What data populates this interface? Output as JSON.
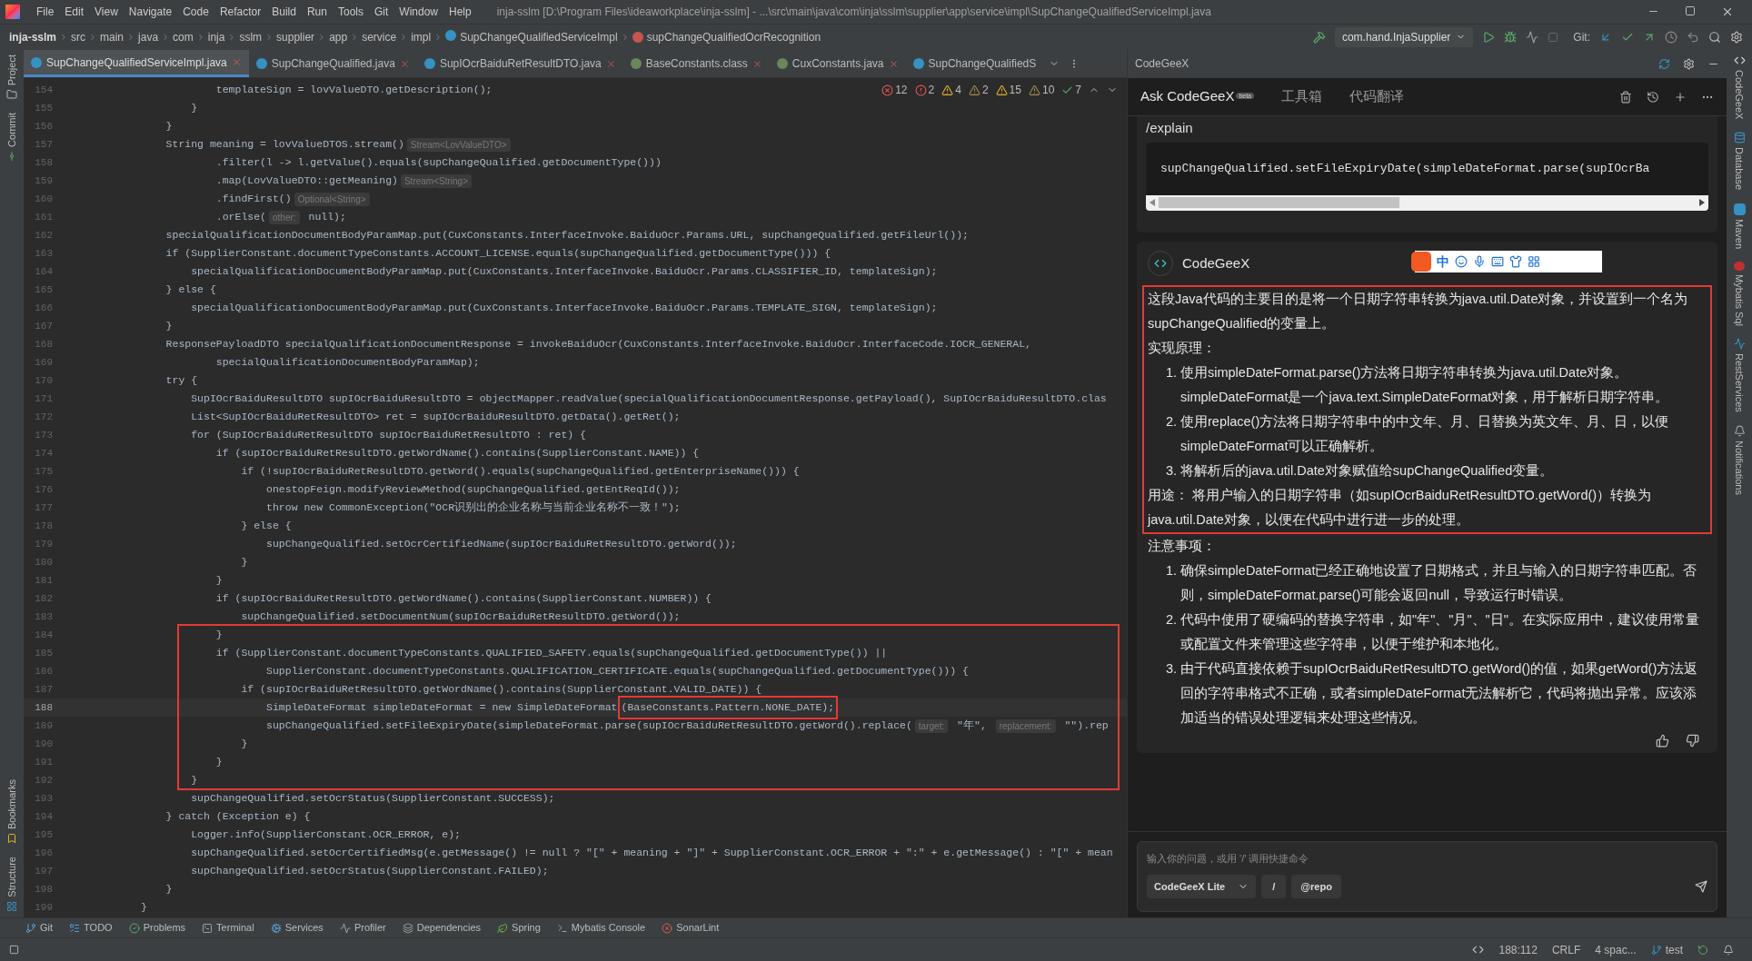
{
  "menu_bar": {
    "items": [
      "File",
      "Edit",
      "View",
      "Navigate",
      "Code",
      "Refactor",
      "Build",
      "Run",
      "Tools",
      "Git",
      "Window",
      "Help"
    ],
    "title": "inja-sslm [D:\\Program Files\\ideaworkplace\\inja-sslm] - ...\\src\\main\\java\\com\\inja\\sslm\\supplier\\app\\service\\impl\\SupChangeQualifiedServiceImpl.java"
  },
  "breadcrumbs": [
    {
      "label": "inja-sslm",
      "kind": "project"
    },
    {
      "label": "src",
      "kind": "folder"
    },
    {
      "label": "main",
      "kind": "folder"
    },
    {
      "label": "java",
      "kind": "folder"
    },
    {
      "label": "com",
      "kind": "folder"
    },
    {
      "label": "inja",
      "kind": "folder"
    },
    {
      "label": "sslm",
      "kind": "folder"
    },
    {
      "label": "supplier",
      "kind": "folder"
    },
    {
      "label": "app",
      "kind": "folder"
    },
    {
      "label": "service",
      "kind": "folder"
    },
    {
      "label": "impl",
      "kind": "folder"
    },
    {
      "label": "SupChangeQualifiedServiceImpl",
      "kind": "class"
    },
    {
      "label": "supChangeQualifiedOcrRecognition",
      "kind": "method"
    }
  ],
  "run_config": "com.hand.InjaSupplier",
  "git_label": "Git:",
  "tabs": [
    {
      "label": "SupChangeQualifiedServiceImpl.java",
      "selected": true,
      "kind": "class"
    },
    {
      "label": "SupChangeQualified.java",
      "selected": false,
      "kind": "class"
    },
    {
      "label": "SupIOcrBaiduRetResultDTO.java",
      "selected": false,
      "kind": "class"
    },
    {
      "label": "BaseConstants.class",
      "selected": false,
      "kind": "compiled"
    },
    {
      "label": "CuxConstants.java",
      "selected": false,
      "kind": "interface"
    },
    {
      "label": "SupChangeQualifiedS",
      "selected": false,
      "kind": "class"
    }
  ],
  "left_tools": {
    "top": [
      "Project",
      "Commit"
    ],
    "bottom": [
      "Bookmarks",
      "Structure"
    ]
  },
  "inspections": [
    {
      "count": "12",
      "kind": "error-outline"
    },
    {
      "count": "2",
      "kind": "error"
    },
    {
      "count": "4",
      "kind": "warning"
    },
    {
      "count": "2",
      "kind": "weak"
    },
    {
      "count": "15",
      "kind": "warning"
    },
    {
      "count": "10",
      "kind": "weak"
    },
    {
      "count": "7",
      "kind": "ok"
    }
  ],
  "code": [
    {
      "number": "154",
      "current": false,
      "parts": [
        {
          "kind": "code",
          "text": "            templateSign = lovValueDTO.getDescription();"
        }
      ]
    },
    {
      "number": "155",
      "current": false,
      "parts": [
        {
          "kind": "code",
          "text": "        }"
        }
      ]
    },
    {
      "number": "156",
      "current": false,
      "parts": [
        {
          "kind": "code",
          "text": "    }"
        }
      ]
    },
    {
      "number": "157",
      "current": false,
      "parts": [
        {
          "kind": "code",
          "text": "    String meaning = lovValueDTOS.stream()"
        },
        {
          "kind": "hint",
          "text": "Stream<LovValueDTO>"
        }
      ]
    },
    {
      "number": "158",
      "current": false,
      "parts": [
        {
          "kind": "code",
          "text": "            .filter(l -> l.getValue().equals(supChangeQualified.getDocumentType()))"
        }
      ]
    },
    {
      "number": "159",
      "current": false,
      "parts": [
        {
          "kind": "code",
          "text": "            .map(LovValueDTO::getMeaning)"
        },
        {
          "kind": "hint",
          "text": "Stream<String>"
        }
      ]
    },
    {
      "number": "160",
      "current": false,
      "parts": [
        {
          "kind": "code",
          "text": "            .findFirst()"
        },
        {
          "kind": "hint",
          "text": "Optional<String>"
        }
      ]
    },
    {
      "number": "161",
      "current": false,
      "parts": [
        {
          "kind": "code",
          "text": "            .orElse("
        },
        {
          "kind": "hint",
          "text": "other:"
        },
        {
          "kind": "code",
          "text": " null);"
        }
      ]
    },
    {
      "number": "162",
      "current": false,
      "parts": [
        {
          "kind": "code",
          "text": "    specialQualificationDocumentBodyParamMap.put(CuxConstants.InterfaceInvoke.BaiduOcr.Params.URL, supChangeQualified.getFileUrl());"
        }
      ]
    },
    {
      "number": "163",
      "current": false,
      "parts": [
        {
          "kind": "code",
          "text": "    if (SupplierConstant.documentTypeConstants.ACCOUNT_LICENSE.equals(supChangeQualified.getDocumentType())) {"
        }
      ]
    },
    {
      "number": "164",
      "current": false,
      "parts": [
        {
          "kind": "code",
          "text": "        specialQualificationDocumentBodyParamMap.put(CuxConstants.InterfaceInvoke.BaiduOcr.Params.CLASSIFIER_ID, templateSign);"
        }
      ]
    },
    {
      "number": "165",
      "current": false,
      "parts": [
        {
          "kind": "code",
          "text": "    } else {"
        }
      ]
    },
    {
      "number": "166",
      "current": false,
      "parts": [
        {
          "kind": "code",
          "text": "        specialQualificationDocumentBodyParamMap.put(CuxConstants.InterfaceInvoke.BaiduOcr.Params.TEMPLATE_SIGN, templateSign);"
        }
      ]
    },
    {
      "number": "167",
      "current": false,
      "parts": [
        {
          "kind": "code",
          "text": "    }"
        }
      ]
    },
    {
      "number": "168",
      "current": false,
      "parts": [
        {
          "kind": "code",
          "text": "    ResponsePayloadDTO specialQualificationDocumentResponse = invokeBaiduOcr(CuxConstants.InterfaceInvoke.BaiduOcr.InterfaceCode.IOCR_GENERAL,"
        }
      ]
    },
    {
      "number": "169",
      "current": false,
      "parts": [
        {
          "kind": "code",
          "text": "            specialQualificationDocumentBodyParamMap);"
        }
      ]
    },
    {
      "number": "170",
      "current": false,
      "parts": [
        {
          "kind": "code",
          "text": "    try {"
        }
      ]
    },
    {
      "number": "171",
      "current": false,
      "parts": [
        {
          "kind": "code",
          "text": "        SupIOcrBaiduResultDTO supIOcrBaiduResultDTO = objectMapper.readValue(specialQualificationDocumentResponse.getPayload(), SupIOcrBaiduResultDTO.clas"
        }
      ]
    },
    {
      "number": "172",
      "current": false,
      "parts": [
        {
          "kind": "code",
          "text": "        List<SupIOcrBaiduRetResultDTO> ret = supIOcrBaiduResultDTO.getData().getRet();"
        }
      ]
    },
    {
      "number": "173",
      "current": false,
      "parts": [
        {
          "kind": "code",
          "text": "        for (SupIOcrBaiduRetResultDTO supIOcrBaiduRetResultDTO : ret) {"
        }
      ]
    },
    {
      "number": "174",
      "current": false,
      "parts": [
        {
          "kind": "code",
          "text": "            if (supIOcrBaiduRetResultDTO.getWordName().contains(SupplierConstant.NAME)) {"
        }
      ]
    },
    {
      "number": "175",
      "current": false,
      "parts": [
        {
          "kind": "code",
          "text": "                if (!supIOcrBaiduRetResultDTO.getWord().equals(supChangeQualified.getEnterpriseName())) {"
        }
      ]
    },
    {
      "number": "176",
      "current": false,
      "parts": [
        {
          "kind": "code",
          "text": "                    onestopFeign.modifyReviewMethod(supChangeQualified.getEntReqId());"
        }
      ]
    },
    {
      "number": "177",
      "current": false,
      "parts": [
        {
          "kind": "code",
          "text": "                    throw new CommonException(\"OCR识别出的企业名称与当前企业名称不一致！\");"
        }
      ]
    },
    {
      "number": "178",
      "current": false,
      "parts": [
        {
          "kind": "code",
          "text": "                } else {"
        }
      ]
    },
    {
      "number": "179",
      "current": false,
      "parts": [
        {
          "kind": "code",
          "text": "                    supChangeQualified.setOcrCertifiedName(supIOcrBaiduRetResultDTO.getWord());"
        }
      ]
    },
    {
      "number": "180",
      "current": false,
      "parts": [
        {
          "kind": "code",
          "text": "                }"
        }
      ]
    },
    {
      "number": "181",
      "current": false,
      "parts": [
        {
          "kind": "code",
          "text": "            }"
        }
      ]
    },
    {
      "number": "182",
      "current": false,
      "parts": [
        {
          "kind": "code",
          "text": "            if (supIOcrBaiduRetResultDTO.getWordName().contains(SupplierConstant.NUMBER)) {"
        }
      ]
    },
    {
      "number": "183",
      "current": false,
      "parts": [
        {
          "kind": "code",
          "text": "                supChangeQualified.setDocumentNum(supIOcrBaiduRetResultDTO.getWord());"
        }
      ]
    },
    {
      "number": "184",
      "current": false,
      "parts": [
        {
          "kind": "code",
          "text": "            }"
        }
      ]
    },
    {
      "number": "185",
      "current": false,
      "parts": [
        {
          "kind": "code",
          "text": "            if (SupplierConstant.documentTypeConstants.QUALIFIED_SAFETY.equals(supChangeQualified.getDocumentType()) ||"
        }
      ]
    },
    {
      "number": "186",
      "current": false,
      "parts": [
        {
          "kind": "code",
          "text": "                    SupplierConstant.documentTypeConstants.QUALIFICATION_CERTIFICATE.equals(supChangeQualified.getDocumentType())) {"
        }
      ]
    },
    {
      "number": "187",
      "current": false,
      "parts": [
        {
          "kind": "code",
          "text": "                if (supIOcrBaiduRetResultDTO.getWordName().contains(SupplierConstant.VALID_DATE)) {"
        }
      ]
    },
    {
      "number": "188",
      "current": true,
      "parts": [
        {
          "kind": "code",
          "text": "                    SimpleDateFormat simpleDateFormat = new SimpleDateFormat"
        },
        {
          "kind": "framed",
          "text": "(BaseConstants.Pattern.NONE_DATE);"
        }
      ]
    },
    {
      "number": "189",
      "current": false,
      "parts": [
        {
          "kind": "code",
          "text": "                    supChangeQualified.setFileExpiryDate(simpleDateFormat.parse(supIOcrBaiduRetResultDTO.getWord().replace("
        },
        {
          "kind": "hint",
          "text": "target:"
        },
        {
          "kind": "code",
          "text": " \"年\", "
        },
        {
          "kind": "hint",
          "text": "replacement:"
        },
        {
          "kind": "code",
          "text": " \"\").rep"
        }
      ]
    },
    {
      "number": "190",
      "current": false,
      "parts": [
        {
          "kind": "code",
          "text": "                }"
        }
      ]
    },
    {
      "number": "191",
      "current": false,
      "parts": [
        {
          "kind": "code",
          "text": "            }"
        }
      ]
    },
    {
      "number": "192",
      "current": false,
      "parts": [
        {
          "kind": "code",
          "text": "        }"
        }
      ]
    },
    {
      "number": "193",
      "current": false,
      "parts": [
        {
          "kind": "code",
          "text": "        supChangeQualified.setOcrStatus(SupplierConstant.SUCCESS);"
        }
      ]
    },
    {
      "number": "194",
      "current": false,
      "parts": [
        {
          "kind": "code",
          "text": "    } catch (Exception e) {"
        }
      ]
    },
    {
      "number": "195",
      "current": false,
      "parts": [
        {
          "kind": "code",
          "text": "        Logger.info(SupplierConstant.OCR_ERROR, e);"
        }
      ]
    },
    {
      "number": "196",
      "current": false,
      "parts": [
        {
          "kind": "code",
          "text": "        supChangeQualified.setOcrCertifiedMsg(e.getMessage() != null ? \"[\" + meaning + \"]\" + SupplierConstant.OCR_ERROR + \":\" + e.getMessage() : \"[\" + mean"
        }
      ]
    },
    {
      "number": "197",
      "current": false,
      "parts": [
        {
          "kind": "code",
          "text": "        supChangeQualified.setOcrStatus(SupplierConstant.FAILED);"
        }
      ]
    },
    {
      "number": "198",
      "current": false,
      "parts": [
        {
          "kind": "code",
          "text": "    }"
        }
      ]
    },
    {
      "number": "199",
      "current": false,
      "parts": [
        {
          "kind": "code",
          "text": "}"
        }
      ]
    }
  ],
  "assistant": {
    "header": "CodeGeeX",
    "tabs": [
      {
        "label": "Ask CodeGeeX",
        "badge": "beta",
        "selected": true
      },
      {
        "label": "工具箱",
        "selected": false
      },
      {
        "label": "代码翻译",
        "selected": false
      }
    ],
    "query": {
      "command": "/explain",
      "code": "supChangeQualified.setFileExpiryDate(simpleDateFormat.parse(supIOcrBa"
    },
    "reply_author": "CodeGeeX",
    "ime_toolbar": {
      "label": "中"
    },
    "framed": [
      {
        "kind": "p",
        "text": "这段Java代码的主要目的是将一个日期字符串转换为java.util.Date对象，并设置到一个名为supChangeQualified的变量上。"
      },
      {
        "kind": "p",
        "text": "实现原理："
      },
      {
        "kind": "ol",
        "items": [
          {
            "number": "1.",
            "text": "使用simpleDateFormat.parse()方法将日期字符串转换为java.util.Date对象。simpleDateFormat是一个java.text.SimpleDateFormat对象，用于解析日期字符串。"
          },
          {
            "number": "2.",
            "text": "使用replace()方法将日期字符串中的中文年、月、日替换为英文年、月、日，以便simpleDateFormat可以正确解析。"
          },
          {
            "number": "3.",
            "text": "将解析后的java.util.Date对象赋值给supChangeQualified变量。"
          }
        ]
      },
      {
        "kind": "p",
        "text": "用途： 将用户输入的日期字符串（如supIOcrBaiduRetResultDTO.getWord()）转换为java.util.Date对象，以便在代码中进行进一步的处理。"
      }
    ],
    "rest": [
      {
        "kind": "p",
        "text": "注意事项："
      },
      {
        "kind": "ol",
        "items": [
          {
            "number": "1.",
            "text": "确保simpleDateFormat已经正确地设置了日期格式，并且与输入的日期字符串匹配。否则，simpleDateFormat.parse()可能会返回null，导致运行时错误。"
          },
          {
            "number": "2.",
            "text": "代码中使用了硬编码的替换字符串，如\"年\"、\"月\"、\"日\"。在实际应用中，建议使用常量或配置文件来管理这些字符串，以便于维护和本地化。"
          },
          {
            "number": "3.",
            "text": "由于代码直接依赖于supIOcrBaiduRetResultDTO.getWord()的值，如果getWord()方法返回的字符串格式不正确，或者simpleDateFormat无法解析它，代码将抛出异常。应该添加适当的错误处理逻辑来处理这些情况。"
          }
        ]
      }
    ],
    "input": {
      "placeholder": "输入你的问题，或用 '/' 调用快捷命令",
      "model": "CodeGeeX Lite",
      "slash": "/",
      "repo": "@repo"
    }
  },
  "right_tools": [
    {
      "label": "CodeGeeX",
      "kind": "codegeex"
    },
    {
      "label": "Database",
      "kind": "database"
    },
    {
      "label": "Maven",
      "kind": "maven"
    },
    {
      "label": "Mybatis Sql",
      "kind": "mybatis"
    },
    {
      "label": "RestServices",
      "kind": "rest"
    },
    {
      "label": "Notifications",
      "kind": "bell"
    }
  ],
  "tool_windows": [
    {
      "label": "Git",
      "kind": "git"
    },
    {
      "label": "TODO",
      "kind": "todo"
    },
    {
      "label": "Problems",
      "kind": "problems"
    },
    {
      "label": "Terminal",
      "kind": "terminal"
    },
    {
      "label": "Services",
      "kind": "services"
    },
    {
      "label": "Profiler",
      "kind": "profiler"
    },
    {
      "label": "Dependencies",
      "kind": "deps"
    },
    {
      "label": "Spring",
      "kind": "spring"
    },
    {
      "label": "Mybatis Console",
      "kind": "console"
    },
    {
      "label": "SonarLint",
      "kind": "sonar"
    }
  ],
  "status_bar": {
    "position": "188:112",
    "line_ending": "CRLF",
    "indent": "4 spac...",
    "branch": "test"
  }
}
